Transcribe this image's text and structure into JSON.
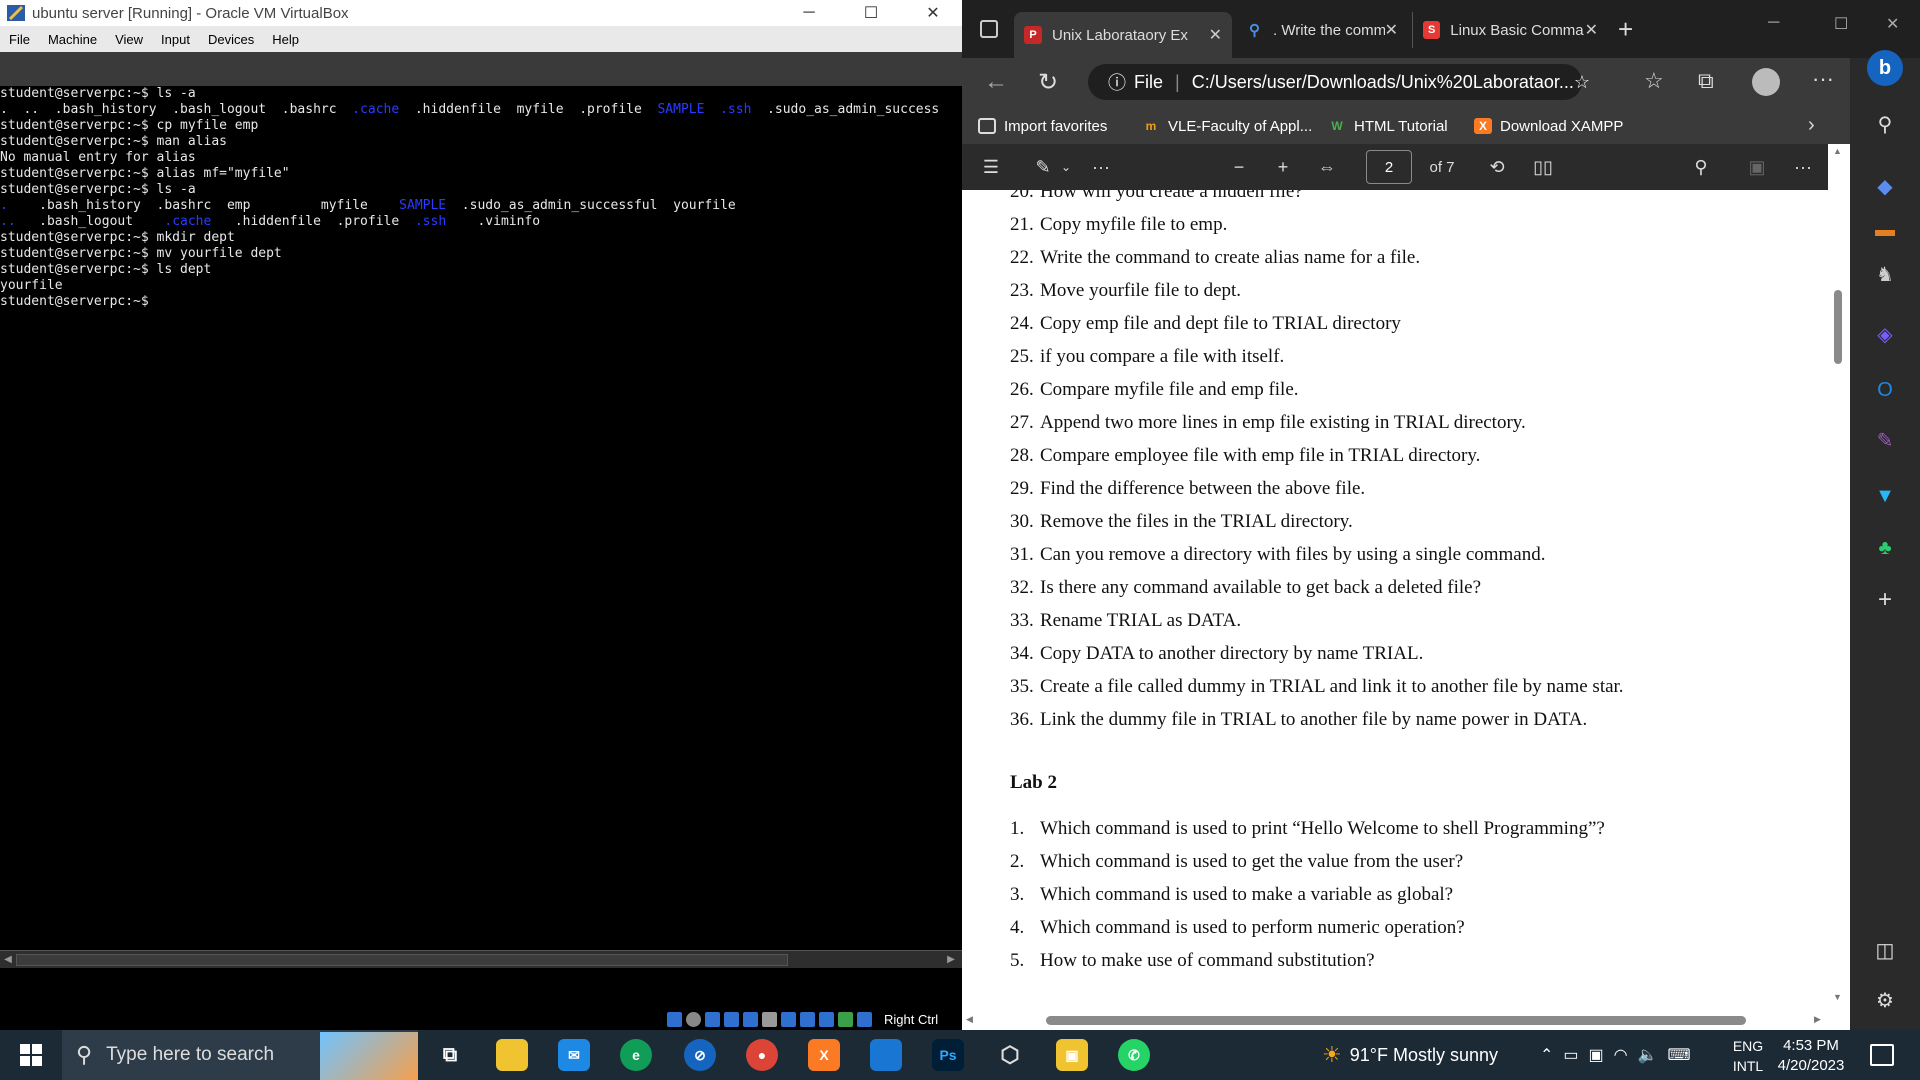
{
  "vbox": {
    "title": "ubuntu server [Running] - Oracle VM VirtualBox",
    "menu": [
      "File",
      "Machine",
      "View",
      "Input",
      "Devices",
      "Help"
    ],
    "host_key": "Right Ctrl"
  },
  "terminal": {
    "lines": [
      [
        {
          "t": "student@serverpc:~$ ls -a"
        }
      ],
      [
        {
          "t": ".  ..  ",
          "b": false
        },
        {
          "t": ".bash_history  .bash_logout  .bashrc  "
        },
        {
          "t": ".cache",
          "b": true
        },
        {
          "t": "  .hiddenfile  myfile  .profile  "
        },
        {
          "t": "SAMPLE",
          "b": true
        },
        {
          "t": "  "
        },
        {
          "t": ".ssh",
          "b": true
        },
        {
          "t": "  .sudo_as_admin_success"
        }
      ],
      [
        {
          "t": "student@serverpc:~$ cp myfile emp"
        }
      ],
      [
        {
          "t": "student@serverpc:~$ man alias"
        }
      ],
      [
        {
          "t": "No manual entry for alias"
        }
      ],
      [
        {
          "t": "student@serverpc:~$ alias mf=\"myfile\""
        }
      ],
      [
        {
          "t": "student@serverpc:~$ ls -a"
        }
      ],
      [
        {
          "t": ".",
          "b": true
        },
        {
          "t": "    .bash_history  .bashrc  emp         myfile    "
        },
        {
          "t": "SAMPLE",
          "b": true
        },
        {
          "t": "  .sudo_as_admin_successful  yourfile"
        }
      ],
      [
        {
          "t": "..",
          "b": true
        },
        {
          "t": "   .bash_logout    "
        },
        {
          "t": ".cache",
          "b": true
        },
        {
          "t": "   .hiddenfile  .profile  "
        },
        {
          "t": ".ssh",
          "b": true
        },
        {
          "t": "    .viminfo"
        }
      ],
      [
        {
          "t": "student@serverpc:~$ mkdir dept"
        }
      ],
      [
        {
          "t": "student@serverpc:~$ mv yourfile dept"
        }
      ],
      [
        {
          "t": "student@serverpc:~$ ls dept"
        }
      ],
      [
        {
          "t": "yourfile"
        }
      ],
      [
        {
          "t": "student@serverpc:~$"
        }
      ]
    ]
  },
  "edge": {
    "tabs": [
      {
        "label": "Unix Laborataory Ex",
        "icon": "pdf-icon",
        "active": true
      },
      {
        "label": ". Write the comman",
        "icon": "search-icon",
        "active": false
      },
      {
        "label": "Linux Basic Comma",
        "icon": "s-icon",
        "active": false
      }
    ],
    "address": {
      "prefix": "File",
      "url": "C:/Users/user/Downloads/Unix%20Laborataor..."
    },
    "favorites": [
      {
        "label": "Import favorites",
        "icon": "import-icon"
      },
      {
        "label": "VLE-Faculty of Appl...",
        "icon": "vle-icon"
      },
      {
        "label": "HTML Tutorial",
        "icon": "w3-icon"
      },
      {
        "label": "Download XAMPP",
        "icon": "xampp-icon"
      }
    ],
    "pdf": {
      "page": "2",
      "of": "of 7"
    }
  },
  "document": {
    "questions": [
      {
        "n": "20.",
        "text": "How will you create a hidden file?"
      },
      {
        "n": "21.",
        "text": "Copy myfile file to emp."
      },
      {
        "n": "22.",
        "text": "Write the command to create alias name for a file."
      },
      {
        "n": "23.",
        "text": "Move yourfile file to dept."
      },
      {
        "n": "24.",
        "text": "Copy emp file and dept file to TRIAL directory"
      },
      {
        "n": "25.",
        "text": "if you compare a file with itself."
      },
      {
        "n": "26.",
        "text": "Compare myfile file and emp file."
      },
      {
        "n": "27.",
        "text": "Append two more lines in emp file existing in TRIAL directory."
      },
      {
        "n": "28.",
        "text": "Compare employee file with emp file in TRIAL directory."
      },
      {
        "n": "29.",
        "text": "Find the difference between the above file."
      },
      {
        "n": "30.",
        "text": "Remove the files in the TRIAL directory."
      },
      {
        "n": "31.",
        "text": "Can you remove a directory with files by using a single command."
      },
      {
        "n": "32.",
        "text": "Is there any command available to get back a deleted file?"
      },
      {
        "n": "33.",
        "text": "Rename TRIAL as DATA."
      },
      {
        "n": "34.",
        "text": "Copy DATA to another directory by name TRIAL."
      },
      {
        "n": "35.",
        "text": "Create a file called dummy in TRIAL and link it to another file by name star."
      },
      {
        "n": "36.",
        "text": "Link the dummy file in TRIAL to another file by name power in DATA."
      }
    ],
    "lab2_heading": "Lab 2",
    "lab2": [
      {
        "n": "1.",
        "text": "Which command is used to print “Hello Welcome to shell Programming”?"
      },
      {
        "n": "2.",
        "text": "Which command is used to get the value from the user?"
      },
      {
        "n": "3.",
        "text": "Which command is used to make a variable as global?"
      },
      {
        "n": "4.",
        "text": "Which command is used to perform numeric operation?"
      },
      {
        "n": "5.",
        "text": "How to make use of command substitution?"
      }
    ]
  },
  "taskbar": {
    "search_placeholder": "Type here to search",
    "weather": "91°F  Mostly sunny",
    "lang1": "ENG",
    "lang2": "INTL",
    "time": "4:53 PM",
    "date": "4/20/2023"
  },
  "colors": {
    "terminal_blue": "#2a3cff",
    "edge_dark": "#202020",
    "taskbar": "#1c2a36"
  }
}
